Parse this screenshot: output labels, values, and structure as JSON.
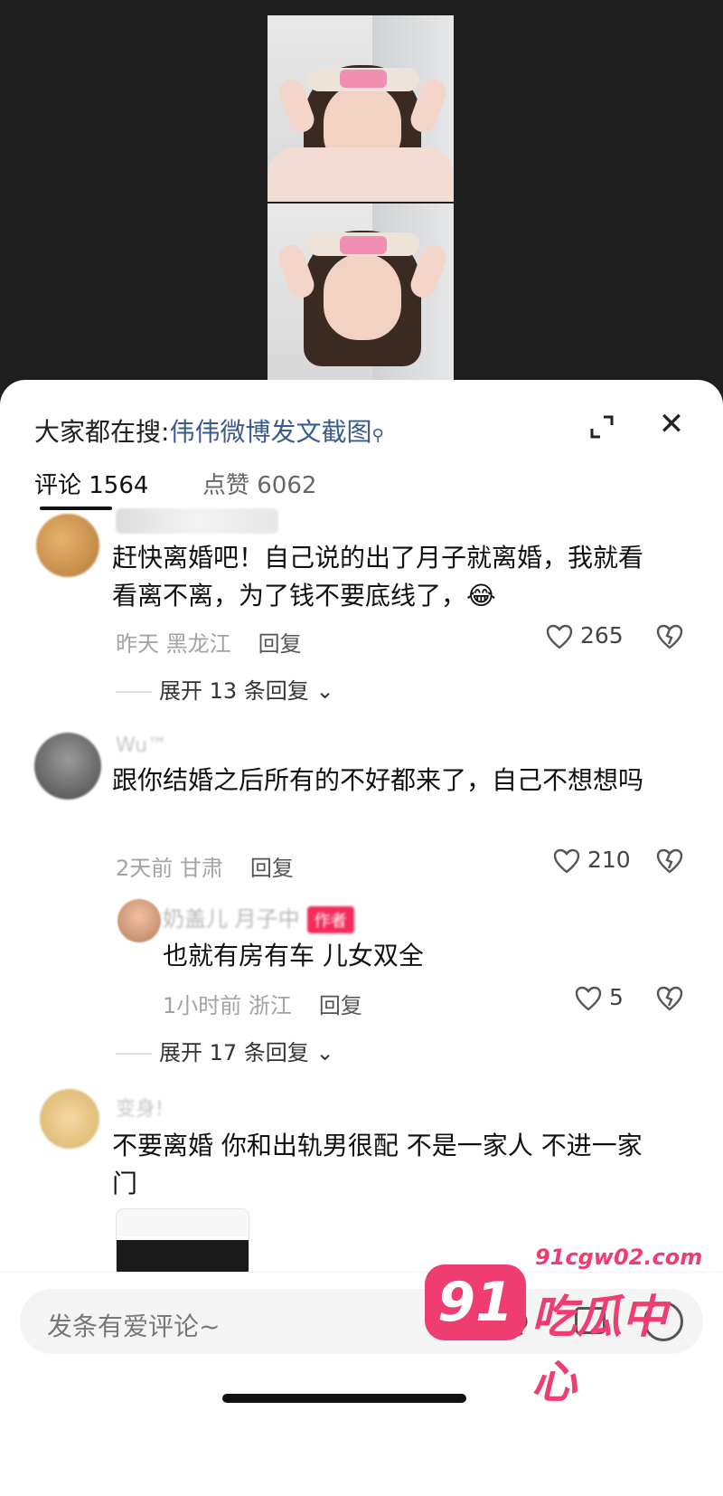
{
  "search": {
    "prefix": "大家都在搜:",
    "keyword": "伟伟微博发文截图"
  },
  "tabs": [
    {
      "label": "评论 1564"
    },
    {
      "label": "点赞 6062"
    }
  ],
  "comments": [
    {
      "text": "赶快离婚吧！自己说的出了月子就离婚，我就看看离不离，为了钱不要底线了，😂",
      "meta": "昨天 黑龙江",
      "reply_label": "回复",
      "likes": "265",
      "expand": "展开 13 条回复"
    },
    {
      "name": "Wu™",
      "text": "跟你结婚之后所有的不好都来了，自己不想想吗",
      "meta": "2天前 甘肃",
      "reply_label": "回复",
      "likes": "210",
      "reply": {
        "name": "奶盖儿  月子中",
        "tag": "作者",
        "text": "也就有房有车 儿女双全",
        "meta": "1小时前 浙江",
        "reply_label": "回复",
        "likes": "5"
      },
      "expand": "展开 17 条回复"
    },
    {
      "name": "变身!",
      "text": "不要离婚 你和出轨男很配 不是一家人 不进一家门"
    }
  ],
  "input": {
    "placeholder": "发条有爱评论~"
  },
  "watermark": {
    "badge": "91",
    "domain": "91cgw02.com",
    "name": "吃瓜中心"
  },
  "colors": {
    "accent": "#3a5a8e",
    "author_tag": "#f52c5a",
    "watermark": "#ef3d72"
  }
}
